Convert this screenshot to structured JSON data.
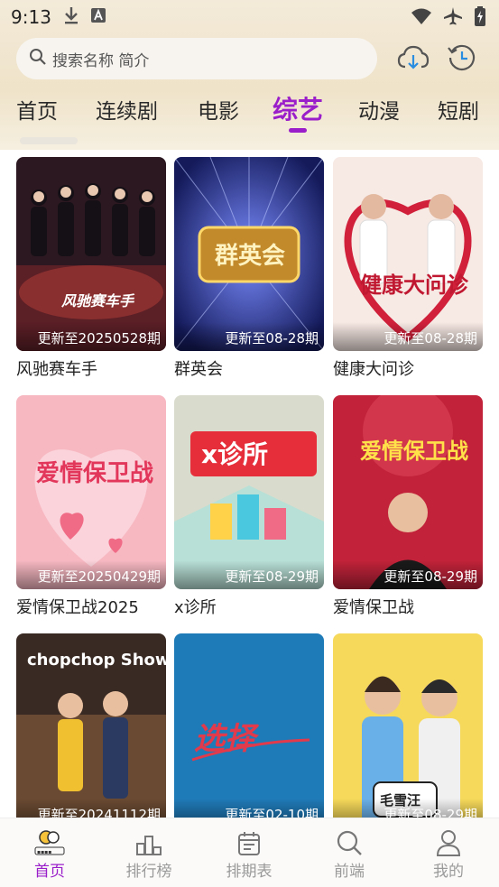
{
  "status": {
    "time": "9:13"
  },
  "search": {
    "placeholder": "搜索名称 简介"
  },
  "tabs": [
    {
      "label": "首页",
      "active": false
    },
    {
      "label": "连续剧",
      "active": false
    },
    {
      "label": "电影",
      "active": false
    },
    {
      "label": "综艺",
      "active": true
    },
    {
      "label": "动漫",
      "active": false
    },
    {
      "label": "短剧",
      "active": false
    }
  ],
  "cards": [
    {
      "title": "风驰赛车手",
      "update": "更新至20250528期",
      "poster_text": "风驰赛车手"
    },
    {
      "title": "群英会",
      "update": "更新至08-28期",
      "poster_text": "群英会"
    },
    {
      "title": "健康大问诊",
      "update": "更新至08-28期",
      "poster_text": "健康大问诊"
    },
    {
      "title": "爱情保卫战2025",
      "update": "更新至20250429期",
      "poster_text": "爱情保卫战"
    },
    {
      "title": "x诊所",
      "update": "更新至08-29期",
      "poster_text": "x诊所"
    },
    {
      "title": "爱情保卫战",
      "update": "更新至08-29期",
      "poster_text": "爱情保卫战"
    },
    {
      "title": "",
      "update": "更新至20241112期",
      "poster_text": "chopchop Show"
    },
    {
      "title": "",
      "update": "更新至02-10期",
      "poster_text": "选择"
    },
    {
      "title": "",
      "update": "更新至08-29期",
      "poster_text": "毛雪汪"
    }
  ],
  "nav": [
    {
      "label": "首页",
      "icon": "home-logo-icon",
      "active": true
    },
    {
      "label": "排行榜",
      "icon": "ranking-icon",
      "active": false
    },
    {
      "label": "排期表",
      "icon": "calendar-icon",
      "active": false
    },
    {
      "label": "前端",
      "icon": "search-icon",
      "active": false
    },
    {
      "label": "我的",
      "icon": "user-icon",
      "active": false
    }
  ],
  "colors": {
    "accent": "#9a1ec9",
    "header_bg": "#efe3c9"
  }
}
